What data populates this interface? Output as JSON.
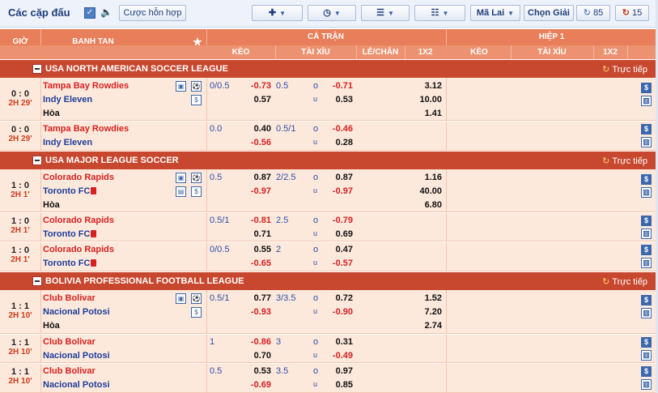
{
  "toolbar": {
    "title": "Các cặp đấu",
    "parlay_label": "Cược hỗn hợp",
    "odds_type_label": "Mã Lai",
    "choose_league_label": "Chọn Giải",
    "refresh_a_count": "85",
    "refresh_b_count": "15"
  },
  "header": {
    "time": "GIỜ",
    "match": "BANH TAN",
    "full_time": "CẢ TRẬN",
    "first_half": "HIỆP 1",
    "ft_cols": [
      "KÈO",
      "TÀI XỈU",
      "LẺ/CHẴN",
      "1X2"
    ],
    "ht_cols": [
      "KÈO",
      "TÀI XỈU",
      "1X2"
    ]
  },
  "live_label": "Trực tiếp",
  "leagues": [
    {
      "name": "USA NORTH AMERICAN SOCCER LEAGUE",
      "rows": [
        {
          "score": "0 : 0",
          "time": "2H 29'",
          "home": "Tampa Bay Rowdies",
          "away": "Indy Eleven",
          "draw": "Hòa",
          "hdp": "0/0.5",
          "hdp_h": "-0.73",
          "hdp_a": "0.57",
          "ou": "0.5",
          "ou_o": "o",
          "ou_u": "u",
          "ou_h": "-0.71",
          "ou_a": "0.53",
          "x12_h": "3.12",
          "x12_a": "10.00",
          "x12_d": "1.41"
        },
        {
          "score": "0 : 0",
          "time": "2H 29'",
          "home": "Tampa Bay Rowdies",
          "away": "Indy Eleven",
          "hdp": "0.0",
          "hdp_h": "0.40",
          "hdp_a": "-0.56",
          "ou": "0.5/1",
          "ou_o": "o",
          "ou_u": "u",
          "ou_h": "-0.46",
          "ou_a": "0.28"
        }
      ]
    },
    {
      "name": "USA MAJOR LEAGUE SOCCER",
      "rows": [
        {
          "score": "1 : 0",
          "time": "2H 1'",
          "home": "Colorado Rapids",
          "away": "Toronto FC",
          "draw": "Hòa",
          "hdp": "0.5",
          "hdp_h": "0.87",
          "hdp_a": "-0.97",
          "ou": "2/2.5",
          "ou_o": "o",
          "ou_u": "u",
          "ou_h": "0.87",
          "ou_a": "-0.97",
          "x12_h": "1.16",
          "x12_a": "40.00",
          "x12_d": "6.80"
        },
        {
          "score": "1 : 0",
          "time": "2H 1'",
          "home": "Colorado Rapids",
          "away": "Toronto FC",
          "hdp": "0.5/1",
          "hdp_h": "-0.81",
          "hdp_a": "0.71",
          "ou": "2.5",
          "ou_o": "o",
          "ou_u": "u",
          "ou_h": "-0.79",
          "ou_a": "0.69"
        },
        {
          "score": "1 : 0",
          "time": "2H 1'",
          "home": "Colorado Rapids",
          "away": "Toronto FC",
          "hdp": "0/0.5",
          "hdp_h": "0.55",
          "hdp_a": "-0.65",
          "ou": "2",
          "ou_o": "o",
          "ou_u": "u",
          "ou_h": "0.47",
          "ou_a": "-0.57"
        }
      ]
    },
    {
      "name": "BOLIVIA PROFESSIONAL FOOTBALL LEAGUE",
      "rows": [
        {
          "score": "1 : 1",
          "time": "2H 10'",
          "home": "Club Bolivar",
          "away": "Nacional Potosi",
          "draw": "Hòa",
          "hdp": "0.5/1",
          "hdp_h": "0.77",
          "hdp_a": "-0.93",
          "ou": "3/3.5",
          "ou_o": "o",
          "ou_u": "u",
          "ou_h": "0.72",
          "ou_a": "-0.90",
          "x12_h": "1.52",
          "x12_a": "7.20",
          "x12_d": "2.74"
        },
        {
          "score": "1 : 1",
          "time": "2H 10'",
          "home": "Club Bolivar",
          "away": "Nacional Potosi",
          "hdp": "1",
          "hdp_h": "-0.86",
          "hdp_a": "0.70",
          "ou": "3",
          "ou_o": "o",
          "ou_u": "u",
          "ou_h": "0.31",
          "ou_a": "-0.49"
        },
        {
          "score": "1 : 1",
          "time": "2H 10'",
          "home": "Club Bolivar",
          "away": "Nacional Potosi",
          "hdp": "0.5",
          "hdp_h": "0.53",
          "hdp_a": "-0.69",
          "ou": "3.5",
          "ou_o": "o",
          "ou_u": "u",
          "ou_h": "0.97",
          "ou_a": "0.85"
        }
      ]
    }
  ]
}
